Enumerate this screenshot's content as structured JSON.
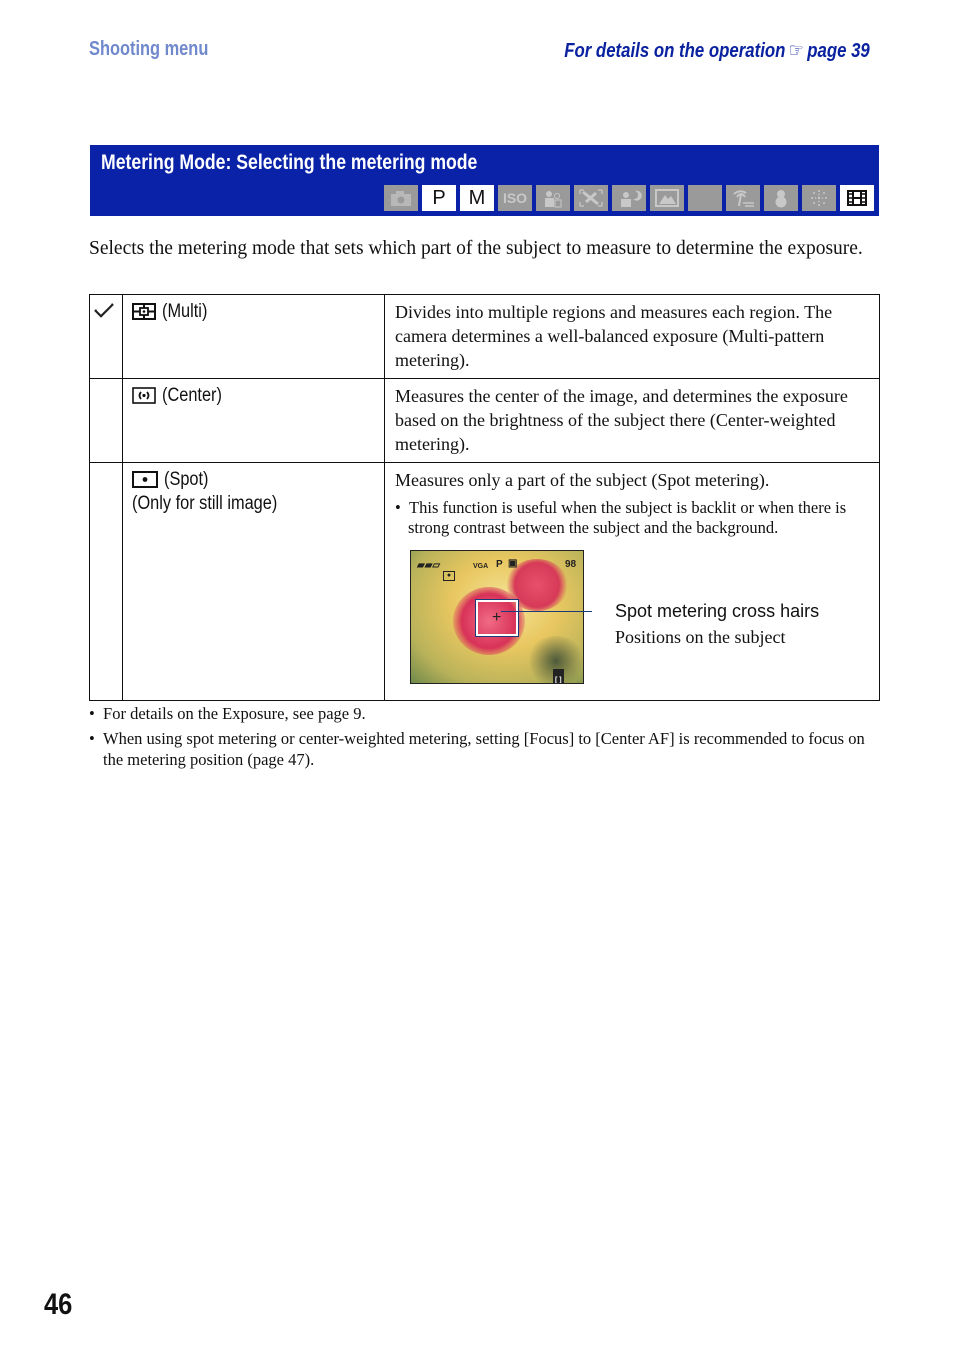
{
  "header": {
    "section": "Shooting menu",
    "details_prefix": "For details on the operation",
    "details_icon": "pointing-hand-icon",
    "details_page": "page 39"
  },
  "banner": {
    "title": "Metering Mode: Selecting the metering mode",
    "mode_icons": [
      {
        "name": "auto-camera-icon",
        "label": "",
        "active": false
      },
      {
        "name": "program-mode-icon",
        "label": "P",
        "active": true
      },
      {
        "name": "manual-mode-icon",
        "label": "M",
        "active": true
      },
      {
        "name": "high-sensitivity-icon",
        "label": "ISO",
        "active": false
      },
      {
        "name": "soft-snap-icon",
        "label": "",
        "active": false
      },
      {
        "name": "sports-icon",
        "label": "",
        "active": false
      },
      {
        "name": "twilight-portrait-icon",
        "label": "",
        "active": false
      },
      {
        "name": "landscape-icon",
        "label": "",
        "active": false
      },
      {
        "name": "twilight-icon",
        "label": "",
        "active": false
      },
      {
        "name": "beach-icon",
        "label": "",
        "active": false
      },
      {
        "name": "snow-icon",
        "label": "",
        "active": false
      },
      {
        "name": "fireworks-icon",
        "label": "",
        "active": false
      },
      {
        "name": "movie-mode-icon",
        "label": "",
        "active": true
      }
    ]
  },
  "intro": "Selects the metering mode that sets which part of the subject to measure to determine the exposure.",
  "modes": [
    {
      "default": true,
      "icon": "multi-metering-icon",
      "label": "(Multi)",
      "sublabel": "",
      "description": "Divides into multiple regions and measures each region. The camera determines a well-balanced exposure (Multi-pattern metering)."
    },
    {
      "default": false,
      "icon": "center-metering-icon",
      "label": "(Center)",
      "sublabel": "",
      "description": "Measures the center of the image, and determines the exposure based on the brightness of the subject there (Center-weighted metering)."
    },
    {
      "default": false,
      "icon": "spot-metering-icon",
      "label": "(Spot)",
      "sublabel": "(Only for still image)",
      "description": "Measures only a part of the subject (Spot metering).",
      "note": "This function is useful when the subject is backlit or when there is strong contrast between the subject and the background.",
      "preview": {
        "lcd_mode": "P",
        "lcd_shots_remaining": "98",
        "lcd_size": "VGA",
        "callout_title": "Spot metering cross hairs",
        "callout_sub": "Positions on the subject"
      }
    }
  ],
  "notes": [
    "For details on the Exposure, see page 9.",
    "When using spot metering or center-weighted metering, setting [Focus] to [Center AF] is recommended to focus on the metering position (page 47)."
  ],
  "page_number": "46",
  "colors": {
    "banner": "#0a22a8",
    "section_header": "#7088cc",
    "details_link": "#0a22a0",
    "inactive_icon": "#9a9a9a"
  }
}
